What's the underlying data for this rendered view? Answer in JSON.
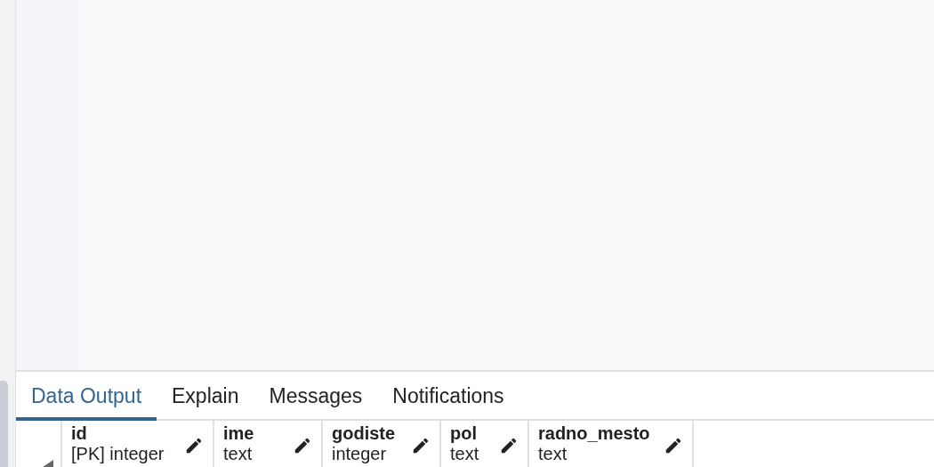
{
  "tabs": [
    {
      "label": "Data Output",
      "selected": true
    },
    {
      "label": "Explain",
      "selected": false
    },
    {
      "label": "Messages",
      "selected": false
    },
    {
      "label": "Notifications",
      "selected": false
    }
  ],
  "table": {
    "columns": [
      {
        "name": "id",
        "type": "[PK] integer"
      },
      {
        "name": "ime",
        "type": "text"
      },
      {
        "name": "godiste",
        "type": "integer"
      },
      {
        "name": "pol",
        "type": "text"
      },
      {
        "name": "radno_mesto",
        "type": "text"
      }
    ]
  }
}
